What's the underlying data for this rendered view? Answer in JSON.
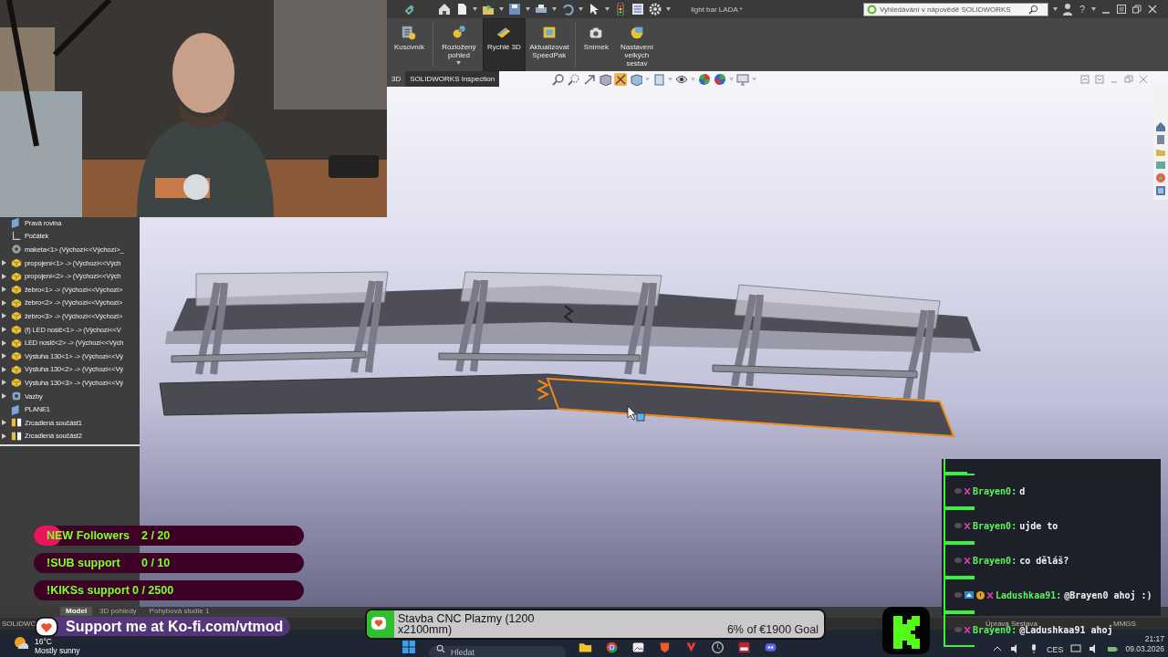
{
  "window": {
    "title": "light bar LADA *"
  },
  "help_search": {
    "placeholder": "Vyhledávání v nápovědě SOLIDWORKS"
  },
  "help_button": "?",
  "ribbon": [
    {
      "label": "Kusovník",
      "selected": false,
      "dropdown": false
    },
    {
      "label": "Rozložený pohled",
      "selected": false,
      "dropdown": true
    },
    {
      "label": "Rychlé 3D",
      "selected": true,
      "dropdown": false
    },
    {
      "label": "Aktualizovat SpeedPak",
      "selected": false,
      "dropdown": false
    },
    {
      "label": "Snímek",
      "selected": false,
      "dropdown": false
    },
    {
      "label": "Nastavení velkých sestav",
      "selected": false,
      "dropdown": false
    }
  ],
  "command_tabs": [
    {
      "label": "3D",
      "selected": false
    },
    {
      "label": "SOLIDWORKS Inspection",
      "selected": true
    }
  ],
  "tree": [
    {
      "label": "Pravá rovina",
      "kind": "plane",
      "expandable": false
    },
    {
      "label": "Počátek",
      "kind": "origin",
      "expandable": false
    },
    {
      "label": "maketa<1> (Výchozí<<Výchozí>_",
      "kind": "part",
      "expandable": false
    },
    {
      "label": "propojení<1> -> (Výchozí<<Vých",
      "kind": "component",
      "expandable": true
    },
    {
      "label": "propojení<2> -> (Výchozí<<Vých",
      "kind": "component",
      "expandable": true
    },
    {
      "label": "žebro<1> -> (Výchozí<<Výchozí>",
      "kind": "component",
      "expandable": true
    },
    {
      "label": "žebro<2> -> (Výchozí<<Výchozí>",
      "kind": "component",
      "expandable": true
    },
    {
      "label": "žebro<3> -> (Výchozí<<Výchozí>",
      "kind": "component",
      "expandable": true
    },
    {
      "label": "(f) LED nosič<1> -> (Výchozí<<V",
      "kind": "component",
      "expandable": true
    },
    {
      "label": "LED nosič<2> -> (Výchozí<<Vých",
      "kind": "component",
      "expandable": true
    },
    {
      "label": "Výstuha 130<1> -> (Výchozí<<Vý",
      "kind": "component",
      "expandable": true
    },
    {
      "label": "Výstuha 130<2> -> (Výchozí<<Vý",
      "kind": "component",
      "expandable": true
    },
    {
      "label": "Výstuha 130<3> -> (Výchozí<<Vý",
      "kind": "component",
      "expandable": true
    },
    {
      "label": "Vazby",
      "kind": "mates",
      "expandable": true
    },
    {
      "label": "PLANE1",
      "kind": "plane",
      "expandable": false
    },
    {
      "label": "Zrcadlená součást1",
      "kind": "mirror",
      "expandable": true
    },
    {
      "label": "Zrcadlená součást2",
      "kind": "mirror",
      "expandable": true
    }
  ],
  "bottom_tabs": [
    {
      "label": "Model",
      "selected": true
    },
    {
      "label": "3D pohledy",
      "selected": false
    },
    {
      "label": "Pohybová studie 1",
      "selected": false
    }
  ],
  "status_bar": {
    "app": "SOLIDWO",
    "mode": "Úprava Sestava",
    "units": "MMGS"
  },
  "taskbar": {
    "temperature": "16°C",
    "weather": "Mostly sunny",
    "search": {
      "placeholder": "Hledat"
    },
    "language": "CES",
    "time": "21:17",
    "date": "09.03.2026"
  },
  "goals": [
    {
      "label": "NEW Followers",
      "count": "2 / 20",
      "level": 0.1
    },
    {
      "label": "!SUB support",
      "count": "0 / 10",
      "level": 0
    },
    {
      "label": "!KIKSs support",
      "count": "0 / 2500",
      "level": 0
    }
  ],
  "kofi_banner": {
    "text": "Support me at Ko-fi.com/vtmod"
  },
  "kofi_goal": {
    "title": "Stavba CNC Plazmy (1200 x2100mm)",
    "progress": "6% of €1900 Goal",
    "level": 0.06
  },
  "chat": [
    {
      "user": "Brayen0:",
      "message": "d",
      "extra_badges": false
    },
    {
      "user": "Brayen0:",
      "message": "ujde to",
      "extra_badges": false
    },
    {
      "user": "Brayen0:",
      "message": "co děláš?",
      "extra_badges": false
    },
    {
      "user": "Ladushkaa91:",
      "message": "@Brayen0 ahoj :)",
      "extra_badges": true
    },
    {
      "user": "Brayen0:",
      "message": "@Ladushkaa91 ahoj",
      "extra_badges": false
    }
  ]
}
